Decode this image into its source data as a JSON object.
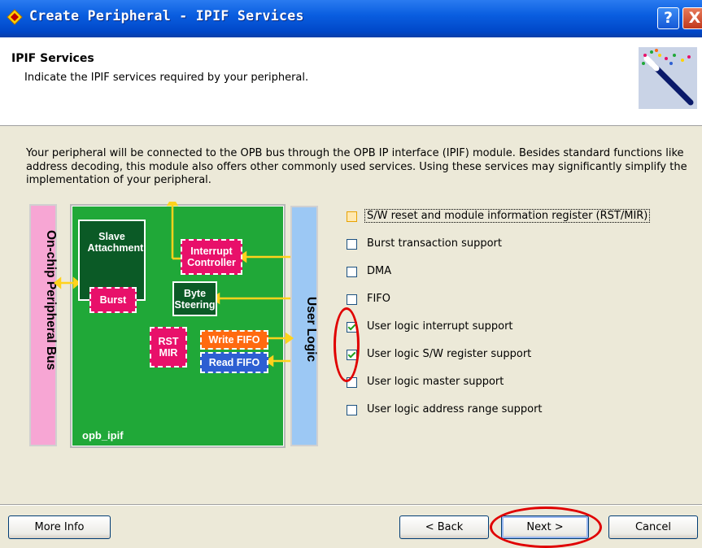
{
  "window": {
    "title": "Create Peripheral - IPIF Services",
    "help_label": "?",
    "close_label": "X"
  },
  "header": {
    "title": "IPIF Services",
    "subtitle": "Indicate the IPIF services required by your peripheral."
  },
  "description": "Your peripheral will be connected to the OPB bus through the OPB IP interface (IPIF) module. Besides standard functions like address decoding, this module also offers other commonly used services. Using these services may significantly simplify the implementation of your peripheral.",
  "diagram": {
    "peripheral_bus": "On-chip Peripheral Bus",
    "user_logic": "User Logic",
    "opb_ipif": "opb_ipif",
    "slave_attachment": "Slave Attachment",
    "burst": "Burst",
    "interrupt_controller": "Interrupt Controller",
    "byte_steering": "Byte Steering",
    "rst_mir": "RST MIR",
    "write_fifo": "Write FIFO",
    "read_fifo": "Read FIFO"
  },
  "options": [
    {
      "label": "S/W reset and module information register (RST/MIR)",
      "checked": false
    },
    {
      "label": "Burst transaction support",
      "checked": false
    },
    {
      "label": "DMA",
      "checked": false
    },
    {
      "label": "FIFO",
      "checked": false
    },
    {
      "label": "User logic interrupt support",
      "checked": true
    },
    {
      "label": "User logic S/W register support",
      "checked": true
    },
    {
      "label": "User logic master support",
      "checked": false
    },
    {
      "label": "User logic address range support",
      "checked": false
    }
  ],
  "buttons": {
    "more_info": "More Info",
    "back": "< Back",
    "next": "Next >",
    "cancel": "Cancel"
  },
  "colors": {
    "highlight": "#e00000",
    "ipif_green": "#20a838"
  }
}
